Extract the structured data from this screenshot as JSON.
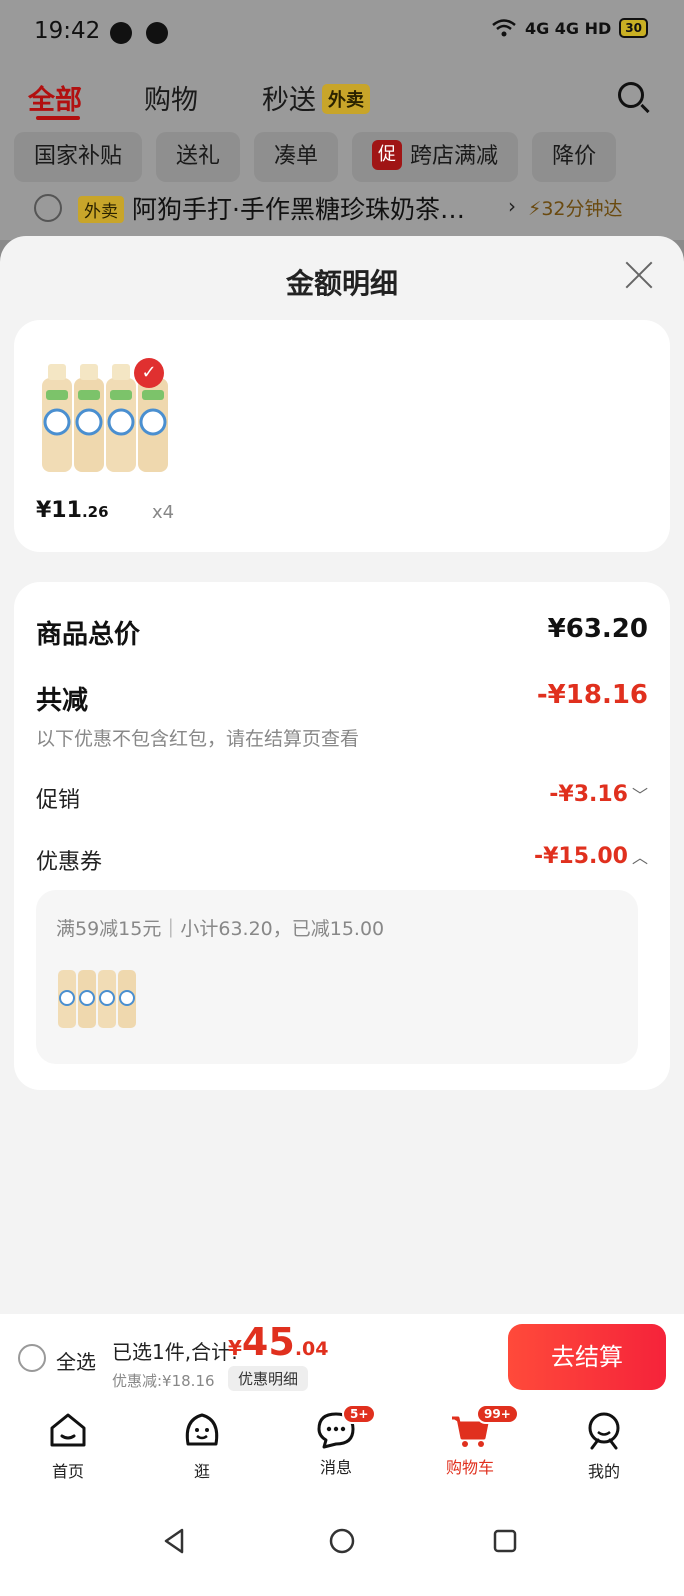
{
  "status_bar": {
    "time": "19:42",
    "network": "4G 4G HD",
    "battery": "30"
  },
  "top_nav": {
    "tabs": [
      "全部",
      "购物",
      "秒送"
    ],
    "waimai_tag": "外卖"
  },
  "chips": [
    "国家补贴",
    "送礼",
    "凑单",
    "跨店满减",
    "降价"
  ],
  "chip_cu_badge": "促",
  "shop_row": {
    "tag": "外卖",
    "name": "阿狗手打·手作黑糖珍珠奶茶…",
    "arrow": "›",
    "eta": "32分钟达"
  },
  "sheet": {
    "title": "金额明细",
    "product": {
      "price_main": "¥11",
      "price_dec": ".26",
      "qty": "x4",
      "checked": "✓"
    },
    "summary": {
      "total_label": "商品总价",
      "total_value": "¥63.20",
      "reduce_label": "共减",
      "reduce_value": "-¥18.16",
      "note": "以下优惠不包含红包，请在结算页查看",
      "promo_label": "促销",
      "promo_value": "-¥3.16",
      "promo_chev": "﹀",
      "coupon_label": "优惠券",
      "coupon_value": "-¥15.00",
      "coupon_chev": "︿",
      "coupon_detail": "满59减15元｜小计63.20，已减15.00"
    }
  },
  "checkout": {
    "select_all": "全选",
    "selected": "已选1件,合计:",
    "amount_symbol": "¥",
    "amount_int": "45",
    "amount_dec": ".04",
    "discount_text": "优惠减:¥18.16",
    "discount_detail_btn": "优惠明细",
    "go_button": "去结算"
  },
  "tabbar": {
    "items": [
      {
        "label": "首页",
        "icon": "home-icon"
      },
      {
        "label": "逛",
        "icon": "browse-icon"
      },
      {
        "label": "消息",
        "icon": "message-icon",
        "badge": "5+"
      },
      {
        "label": "购物车",
        "icon": "cart-icon",
        "badge": "99+"
      },
      {
        "label": "我的",
        "icon": "profile-icon"
      }
    ]
  },
  "colors": {
    "accent": "#e0301e",
    "brand_red": "#b21010",
    "waimai_yellow": "#c8a52a"
  }
}
